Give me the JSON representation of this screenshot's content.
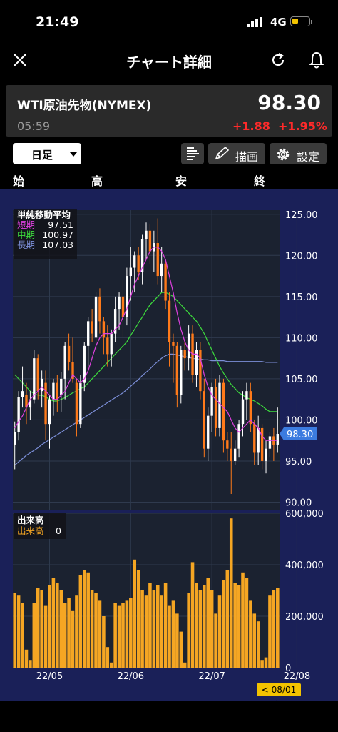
{
  "status": {
    "time": "21:49",
    "network": "4G"
  },
  "nav": {
    "title": "チャート詳細",
    "close_icon": "close-icon",
    "reload_icon": "reload-icon",
    "alert_icon": "bell-icon"
  },
  "quote": {
    "name": "WTI原油先物(NYMEX)",
    "price": "98.30",
    "time": "05:59",
    "change": "+1.88",
    "change_pct": "+1.95%"
  },
  "toolbar": {
    "period": "日足",
    "draw_label": "描画",
    "settings_label": "設定"
  },
  "ohlc_labels": [
    "始",
    "高",
    "安",
    "終"
  ],
  "ma_legend": {
    "title": "単純移動平均",
    "items": [
      {
        "label": "短期",
        "value": "97.51",
        "color": "#e040e0"
      },
      {
        "label": "中期",
        "value": "100.97",
        "color": "#3ddc3d"
      },
      {
        "label": "長期",
        "value": "107.03",
        "color": "#7c8fd8"
      }
    ]
  },
  "volume_legend": {
    "title": "出来高",
    "label": "出来高",
    "value": "0"
  },
  "current_price_tag": "98.30",
  "crosshair_date": "< 08/01 >",
  "colors": {
    "bg": "#1a2058",
    "up": "#ffffff",
    "down": "#ff7a1a",
    "volume": "#f5a623",
    "negative": "#ff2a2a"
  },
  "chart_data": {
    "type": "candlestick",
    "price_axis": {
      "ticks": [
        "125.00",
        "120.00",
        "115.00",
        "110.00",
        "105.00",
        "100.00",
        "95.00",
        "90.00"
      ],
      "ylim": [
        89,
        125.5
      ]
    },
    "volume_axis": {
      "ticks": [
        "600,000",
        "400,000",
        "200,000",
        "0"
      ],
      "ylim": [
        0,
        600000
      ]
    },
    "x_ticks": [
      {
        "label": "22/05",
        "index": 9
      },
      {
        "label": "22/06",
        "index": 30
      },
      {
        "label": "22/07",
        "index": 51
      },
      {
        "label": "22/08",
        "index": 73
      }
    ],
    "candles": [
      [
        97.0,
        99.8,
        94.0,
        98.5
      ],
      [
        98.5,
        103.5,
        97.5,
        102.8
      ],
      [
        102.8,
        106.5,
        101.5,
        103.5
      ],
      [
        103.0,
        104.5,
        99.5,
        101.5
      ],
      [
        101.5,
        103.5,
        100.0,
        102.5
      ],
      [
        102.5,
        108.5,
        102.0,
        107.5
      ],
      [
        107.5,
        108.0,
        102.5,
        103.5
      ],
      [
        103.5,
        106.0,
        101.5,
        105.0
      ],
      [
        104.5,
        106.0,
        97.5,
        99.5
      ],
      [
        99.5,
        103.0,
        96.5,
        102.5
      ],
      [
        102.5,
        105.0,
        100.5,
        104.5
      ],
      [
        104.5,
        105.5,
        101.0,
        102.5
      ],
      [
        103.0,
        105.8,
        101.0,
        105.0
      ],
      [
        105.0,
        109.5,
        102.5,
        109.0
      ],
      [
        109.0,
        110.5,
        106.0,
        107.0
      ],
      [
        107.0,
        110.0,
        104.5,
        105.0
      ],
      [
        104.5,
        105.0,
        98.0,
        99.5
      ],
      [
        99.5,
        105.5,
        99.0,
        104.5
      ],
      [
        104.5,
        109.5,
        103.5,
        109.0
      ],
      [
        109.0,
        112.5,
        106.5,
        112.0
      ],
      [
        112.0,
        113.5,
        109.5,
        110.5
      ],
      [
        110.0,
        115.5,
        108.5,
        115.0
      ],
      [
        115.0,
        116.0,
        110.5,
        112.0
      ],
      [
        112.0,
        112.5,
        108.0,
        110.0
      ],
      [
        110.0,
        111.5,
        106.5,
        108.0
      ],
      [
        108.0,
        111.0,
        106.5,
        110.5
      ],
      [
        110.5,
        115.0,
        109.5,
        113.5
      ],
      [
        113.5,
        115.5,
        111.0,
        115.0
      ],
      [
        115.0,
        117.0,
        110.0,
        112.5
      ],
      [
        112.5,
        118.5,
        111.5,
        117.5
      ],
      [
        117.5,
        121.0,
        114.5,
        118.5
      ],
      [
        118.5,
        120.5,
        115.5,
        120.0
      ],
      [
        120.0,
        121.0,
        117.0,
        118.0
      ],
      [
        118.0,
        122.5,
        116.5,
        122.0
      ],
      [
        122.0,
        124.0,
        119.5,
        123.0
      ],
      [
        123.0,
        123.8,
        119.0,
        120.5
      ],
      [
        120.5,
        123.0,
        118.0,
        121.5
      ],
      [
        121.5,
        124.5,
        116.5,
        117.5
      ],
      [
        117.5,
        121.0,
        115.5,
        119.0
      ],
      [
        119.0,
        119.5,
        113.5,
        114.5
      ],
      [
        114.5,
        115.5,
        106.5,
        109.5
      ],
      [
        109.5,
        110.5,
        104.5,
        109.0
      ],
      [
        109.0,
        109.5,
        101.5,
        103.0
      ],
      [
        103.0,
        109.0,
        102.0,
        108.5
      ],
      [
        108.5,
        109.5,
        106.0,
        107.5
      ],
      [
        107.5,
        111.5,
        106.0,
        110.5
      ],
      [
        110.5,
        111.5,
        104.5,
        105.5
      ],
      [
        105.5,
        109.5,
        104.0,
        108.5
      ],
      [
        108.5,
        109.5,
        102.5,
        103.5
      ],
      [
        103.5,
        105.0,
        95.5,
        96.5
      ],
      [
        96.5,
        101.5,
        95.0,
        100.5
      ],
      [
        100.5,
        104.5,
        98.5,
        104.0
      ],
      [
        104.0,
        105.0,
        98.0,
        99.0
      ],
      [
        99.0,
        105.5,
        98.0,
        104.5
      ],
      [
        104.5,
        105.0,
        96.0,
        97.5
      ],
      [
        97.5,
        98.5,
        95.0,
        96.5
      ],
      [
        96.5,
        98.5,
        91.0,
        95.0
      ],
      [
        95.0,
        97.5,
        94.5,
        96.5
      ],
      [
        96.5,
        100.0,
        95.5,
        99.5
      ],
      [
        99.5,
        103.5,
        98.0,
        102.5
      ],
      [
        102.5,
        104.5,
        100.0,
        103.5
      ],
      [
        103.5,
        104.5,
        98.5,
        99.5
      ],
      [
        99.5,
        100.0,
        94.5,
        96.0
      ],
      [
        96.0,
        100.5,
        94.5,
        99.0
      ],
      [
        99.0,
        99.5,
        94.0,
        95.0
      ],
      [
        95.0,
        97.5,
        93.5,
        96.5
      ],
      [
        96.5,
        98.5,
        95.5,
        98.0
      ],
      [
        98.0,
        99.0,
        95.0,
        97.0
      ],
      [
        97.0,
        101.5,
        96.0,
        98.3
      ]
    ],
    "sma_short": [
      99.0,
      99.8,
      100.5,
      101.5,
      102.5,
      103.0,
      103.5,
      104.0,
      103.5,
      103.0,
      102.5,
      102.5,
      103.0,
      103.5,
      104.5,
      105.5,
      105.0,
      104.5,
      105.0,
      106.0,
      107.5,
      109.0,
      110.0,
      110.5,
      110.5,
      110.5,
      111.0,
      111.5,
      112.5,
      113.5,
      115.0,
      116.5,
      117.5,
      118.5,
      119.5,
      120.5,
      121.0,
      121.0,
      120.5,
      119.5,
      117.5,
      115.5,
      113.0,
      111.0,
      109.5,
      108.5,
      108.0,
      108.0,
      107.5,
      105.5,
      104.0,
      103.0,
      102.5,
      102.0,
      101.5,
      101.0,
      100.0,
      99.0,
      98.5,
      99.0,
      99.5,
      100.0,
      99.5,
      99.0,
      98.0,
      97.5,
      97.5,
      97.5,
      97.5
    ],
    "sma_mid": [
      105.5,
      105.0,
      104.5,
      104.0,
      103.5,
      103.2,
      103.0,
      103.0,
      102.8,
      102.5,
      102.3,
      102.3,
      102.5,
      102.7,
      103.0,
      103.3,
      103.5,
      103.8,
      104.0,
      104.5,
      105.0,
      105.5,
      106.0,
      106.5,
      107.0,
      107.5,
      108.0,
      108.5,
      109.0,
      109.5,
      110.3,
      111.0,
      111.8,
      112.5,
      113.3,
      114.0,
      114.5,
      115.0,
      115.5,
      115.5,
      115.3,
      115.0,
      114.5,
      114.0,
      113.5,
      113.0,
      112.5,
      112.0,
      111.3,
      110.5,
      109.5,
      108.5,
      107.5,
      106.5,
      105.7,
      105.0,
      104.3,
      103.8,
      103.3,
      103.0,
      102.7,
      102.5,
      102.3,
      102.0,
      101.7,
      101.3,
      101.0,
      101.0,
      101.0
    ],
    "sma_long": [
      94.5,
      94.9,
      95.3,
      95.7,
      96.0,
      96.3,
      96.6,
      97.0,
      97.3,
      97.6,
      97.9,
      98.2,
      98.5,
      98.8,
      99.1,
      99.4,
      99.7,
      100.0,
      100.3,
      100.6,
      100.9,
      101.2,
      101.5,
      101.8,
      102.1,
      102.4,
      102.7,
      103.0,
      103.3,
      103.7,
      104.1,
      104.5,
      104.9,
      105.4,
      105.8,
      106.2,
      106.7,
      107.1,
      107.5,
      107.8,
      108.0,
      108.0,
      107.9,
      107.8,
      107.7,
      107.6,
      107.5,
      107.4,
      107.4,
      107.3,
      107.3,
      107.2,
      107.2,
      107.2,
      107.2,
      107.1,
      107.1,
      107.1,
      107.1,
      107.1,
      107.1,
      107.1,
      107.1,
      107.1,
      107.1,
      107.0,
      107.0,
      107.0,
      107.0
    ],
    "volumes": [
      290000,
      280000,
      250000,
      70000,
      30000,
      250000,
      310000,
      300000,
      240000,
      320000,
      350000,
      330000,
      300000,
      250000,
      270000,
      220000,
      280000,
      360000,
      380000,
      370000,
      300000,
      290000,
      260000,
      200000,
      80000,
      20000,
      250000,
      240000,
      250000,
      260000,
      270000,
      420000,
      380000,
      300000,
      280000,
      330000,
      300000,
      320000,
      280000,
      330000,
      240000,
      260000,
      210000,
      140000,
      20000,
      290000,
      410000,
      330000,
      300000,
      320000,
      350000,
      300000,
      210000,
      280000,
      340000,
      380000,
      580000,
      330000,
      320000,
      370000,
      350000,
      260000,
      210000,
      180000,
      30000,
      40000,
      280000,
      300000,
      310000
    ],
    "latest_price": 98.3
  }
}
